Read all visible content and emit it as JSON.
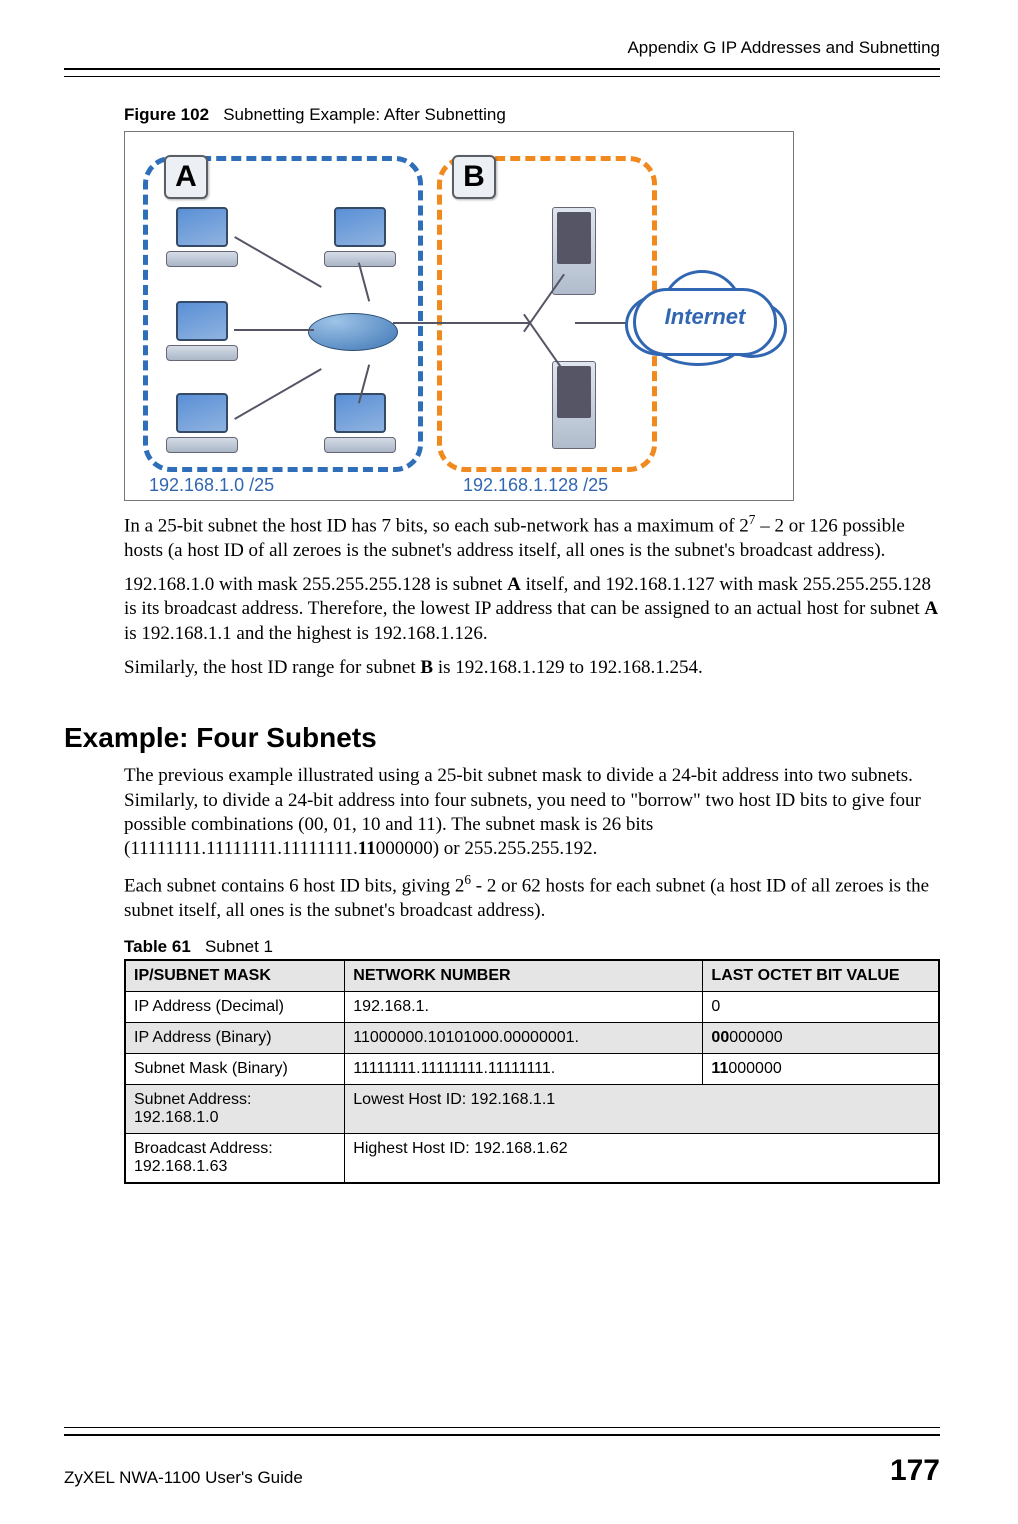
{
  "header": {
    "appendix": "Appendix G IP Addresses and Subnetting"
  },
  "figure": {
    "label": "Figure 102",
    "title": "Subnetting Example: After Subnetting",
    "subnetA": {
      "letter": "A",
      "cidr": "192.168.1.0 /25"
    },
    "subnetB": {
      "letter": "B",
      "cidr": "192.168.1.128 /25"
    },
    "cloud": "Internet"
  },
  "para1": {
    "pre": "In a 25-bit subnet the host ID has 7 bits, so each sub-network has a maximum of 2",
    "exp": "7",
    "post": " – 2 or 126 possible hosts (a host ID of all zeroes is the subnet's address itself, all ones is the subnet's broadcast address)."
  },
  "para2": {
    "t1": "192.168.1.0 with mask 255.255.255.128 is subnet ",
    "b1": "A",
    "t2": " itself, and 192.168.1.127 with mask 255.255.255.128 is its broadcast address. Therefore, the lowest IP address that can be assigned to an actual host for subnet ",
    "b2": "A",
    "t3": " is 192.168.1.1 and the highest is 192.168.1.126."
  },
  "para3": {
    "t1": "Similarly, the host ID range for subnet ",
    "b1": "B",
    "t2": " is 192.168.1.129 to 192.168.1.254."
  },
  "section_heading": "Example: Four Subnets",
  "para4": {
    "t1": "The previous example illustrated using a 25-bit subnet mask to divide a 24-bit address into two subnets. Similarly, to divide a 24-bit address into four subnets, you need to \"borrow\" two host ID bits to give four possible combinations (00, 01, 10 and 11). The subnet mask is 26 bits (11111111.11111111.11111111.",
    "b1": "11",
    "t2": "000000) or 255.255.255.192."
  },
  "para5": {
    "t1": "Each subnet contains 6 host ID bits, giving 2",
    "exp": "6",
    "t2": " - 2 or 62 hosts for each subnet (a host ID of all zeroes is the subnet itself, all ones is the subnet's broadcast address)."
  },
  "table": {
    "label": "Table 61",
    "title": "Subnet 1",
    "headers": {
      "h1": "IP/SUBNET MASK",
      "h2": "NETWORK NUMBER",
      "h3": "LAST OCTET BIT VALUE"
    },
    "rows": [
      {
        "c1": "IP Address (Decimal)",
        "c2": "192.168.1.",
        "c3_pre": "",
        "c3_bold": "",
        "c3_post": "0",
        "shade": false,
        "span": false
      },
      {
        "c1": "IP Address (Binary)",
        "c2": "11000000.10101000.00000001.",
        "c3_pre": "",
        "c3_bold": "00",
        "c3_post": "000000",
        "shade": true,
        "span": false
      },
      {
        "c1": "Subnet Mask (Binary)",
        "c2": "11111111.11111111.11111111.",
        "c3_pre": "",
        "c3_bold": "11",
        "c3_post": "000000",
        "shade": false,
        "span": false
      },
      {
        "c1": "Subnet Address: 192.168.1.0",
        "c2": "Lowest Host ID: 192.168.1.1",
        "c3_pre": "",
        "c3_bold": "",
        "c3_post": "",
        "shade": true,
        "span": true
      },
      {
        "c1": "Broadcast Address: 192.168.1.63",
        "c2": "Highest Host ID: 192.168.1.62",
        "c3_pre": "",
        "c3_bold": "",
        "c3_post": "",
        "shade": false,
        "span": true
      }
    ]
  },
  "footer": {
    "guide": "ZyXEL NWA-1100 User's Guide",
    "page": "177"
  }
}
